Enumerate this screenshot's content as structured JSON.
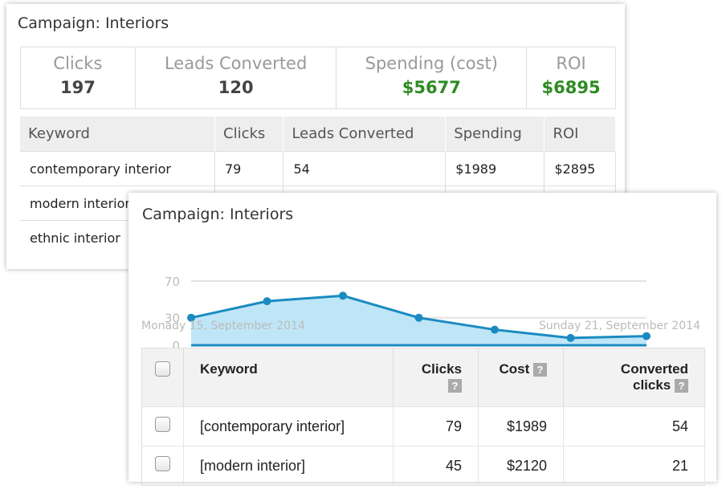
{
  "back": {
    "title": "Campaign: Interiors",
    "stats": [
      {
        "label": "Clicks",
        "value": "197"
      },
      {
        "label": "Leads Converted",
        "value": "120"
      },
      {
        "label": "Spending (cost)",
        "value": "$5677"
      },
      {
        "label": "ROI",
        "value": "$6895"
      }
    ],
    "headers": [
      "Keyword",
      "Clicks",
      "Leads Converted",
      "Spending",
      "ROI"
    ],
    "rows": [
      [
        "contemporary interior",
        "79",
        "54",
        "$1989",
        "$2895"
      ],
      [
        "modern interior",
        "",
        "",
        "",
        ""
      ],
      [
        "ethnic interior",
        "",
        "",
        "",
        ""
      ]
    ]
  },
  "front": {
    "title": "Campaign: Interiors",
    "start_date": "Monady 15, September 2014",
    "end_date": "Sunday 21, September 2014",
    "headers": {
      "keyword": "Keyword",
      "clicks": "Clicks",
      "cost": "Cost",
      "converted": "Converted clicks"
    },
    "help": "?",
    "rows": [
      {
        "keyword": "[contemporary interior]",
        "clicks": "79",
        "cost": "$1989",
        "converted": "54"
      },
      {
        "keyword": "[modern interior]",
        "clicks": "45",
        "cost": "$2120",
        "converted": "21"
      }
    ]
  },
  "chart_data": {
    "type": "area",
    "yticks": [
      "0",
      "30",
      "70"
    ],
    "ylim": [
      0,
      70
    ],
    "values": [
      30,
      48,
      54,
      30,
      17,
      8,
      10
    ],
    "color": "#1a8bc0",
    "fill": "#bfe6f7",
    "grid": true
  }
}
